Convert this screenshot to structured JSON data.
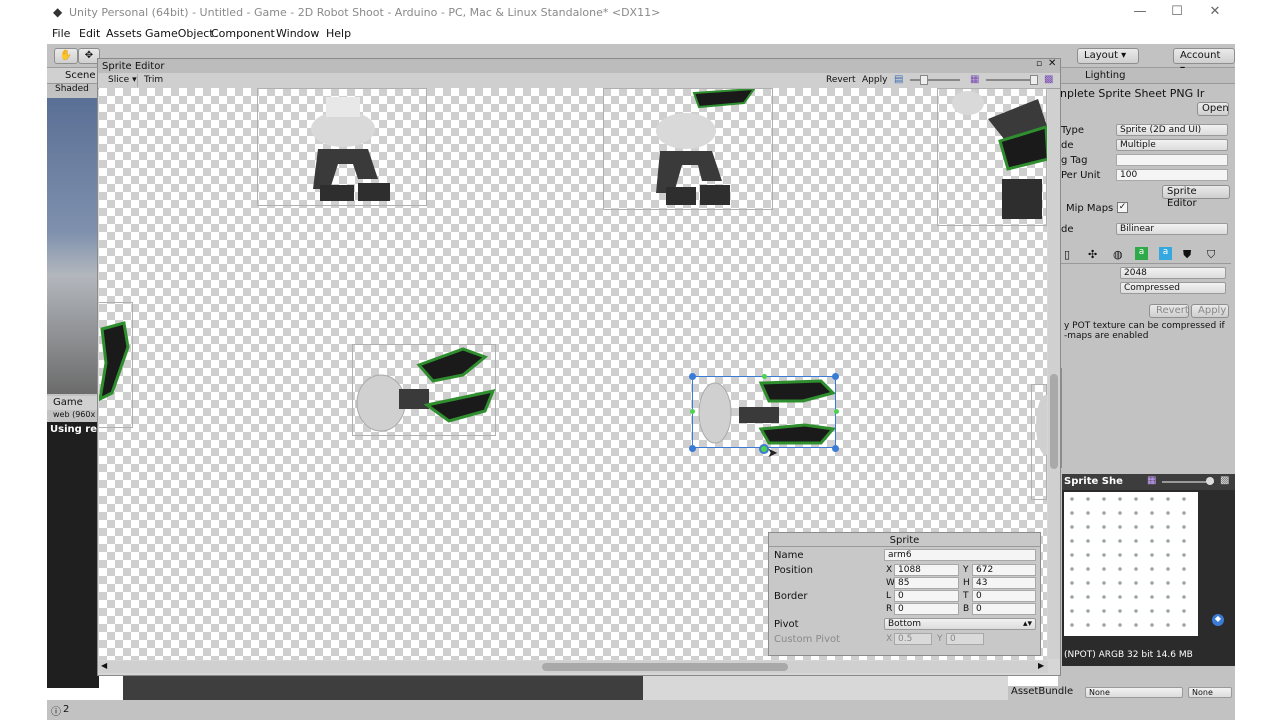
{
  "window": {
    "title": "Unity Personal (64bit) - Untitled - Game - 2D Robot Shoot - Arduino - PC, Mac & Linux Standalone* <DX11>",
    "minimize": "—",
    "maximize": "☐",
    "close": "✕"
  },
  "menu": [
    "File",
    "Edit",
    "Assets",
    "GameObject",
    "Component",
    "Window",
    "Help"
  ],
  "toolbar": {
    "layout": "Layout",
    "account": "Account"
  },
  "left_panel": {
    "scene_tab": "Scene",
    "shaded": "Shaded",
    "game_tab": "Game",
    "web_size": "web (960x",
    "using_text": "Using re"
  },
  "sprite_editor": {
    "tab": "Sprite Editor",
    "slice": "Slice",
    "trim": "Trim",
    "revert": "Revert",
    "apply": "Apply"
  },
  "sprite_panel": {
    "header": "Sprite",
    "name_label": "Name",
    "name_value": "arm6",
    "position_label": "Position",
    "x_label": "X",
    "x_value": "1088",
    "y_label": "Y",
    "y_value": "672",
    "w_label": "W",
    "w_value": "85",
    "h_label": "H",
    "h_value": "43",
    "border_label": "Border",
    "l_label": "L",
    "l_value": "0",
    "t_label": "T",
    "t_value": "0",
    "r_label": "R",
    "r_value": "0",
    "b_label": "B",
    "b_value": "0",
    "pivot_label": "Pivot",
    "pivot_value": "Bottom",
    "custom_pivot_label": "Custom Pivot",
    "cpx_label": "X",
    "cpx_value": "0.5",
    "cpy_label": "Y",
    "cpy_value": "0"
  },
  "inspector": {
    "lighting_tab": "Lighting",
    "asset_title": "nplete Sprite Sheet PNG Ir",
    "open": "Open",
    "type_label": "Type",
    "type_value": "Sprite (2D and UI)",
    "mode_label": "de",
    "mode_value": "Multiple",
    "packing_label": "g Tag",
    "ppu_label": "Per Unit",
    "ppu_value": "100",
    "sprite_editor_btn": "Sprite Editor",
    "mipmaps_label": "Mip Maps",
    "filter_label": "de",
    "filter_value": "Bilinear",
    "max_size": "2048",
    "format": "Compressed",
    "revert": "Revert",
    "apply": "Apply",
    "note_line1": "y POT texture can be compressed if",
    "note_line2": "-maps are enabled",
    "preview_title": "Sprite She",
    "preview_info": "(NPOT)  ARGB 32 bit  14.6 MB",
    "assetbundle_label": "AssetBundle",
    "none1": "None",
    "none2": "None"
  },
  "status": {
    "count": "2"
  },
  "colors": {
    "accent_green": "#2f8f2f",
    "selection_blue": "#3a7bd5",
    "panel_gray": "#c2c2c2"
  }
}
